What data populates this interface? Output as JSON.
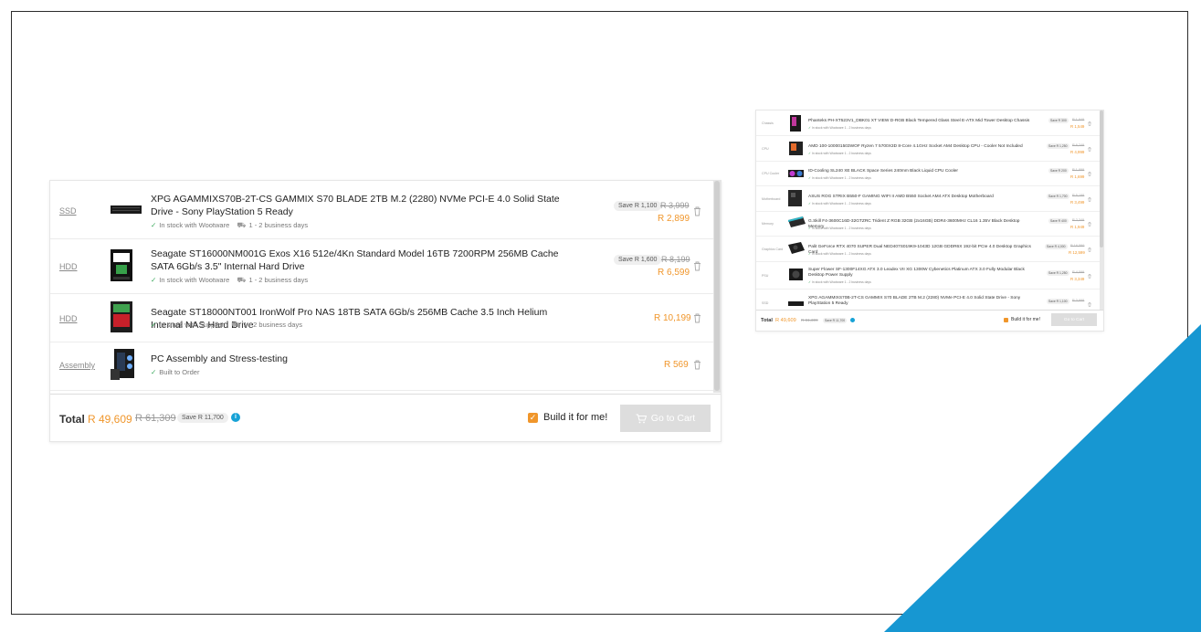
{
  "cart": {
    "items": [
      {
        "category": "SSD",
        "title": "XPG AGAMMIXS70B-2T-CS GAMMIX S70 BLADE 2TB M.2 (2280) NVMe PCI-E 4.0 Solid State Drive - Sony PlayStation 5 Ready",
        "stock": "In stock with Wootware",
        "delivery": "1 - 2 business days",
        "save": "Save R 1,100",
        "old_price": "R 3,999",
        "price": "R 2,899"
      },
      {
        "category": "HDD",
        "title": "Seagate ST16000NM001G Exos X16 512e/4Kn Standard Model 16TB 7200RPM 256MB Cache SATA 6Gb/s 3.5\" Internal Hard Drive",
        "stock": "In stock with Wootware",
        "delivery": "1 - 2 business days",
        "save": "Save R 1,600",
        "old_price": "R 8,199",
        "price": "R 6,599"
      },
      {
        "category": "HDD",
        "title": "Seagate ST18000NT001 IronWolf Pro NAS 18TB SATA 6Gb/s 256MB Cache 3.5 Inch Helium Internal NAS Hard Drive",
        "stock": "In stock with Supplier",
        "delivery": "1 - 2 business days",
        "price": "R 10,199"
      },
      {
        "category": "Assembly",
        "title": "PC Assembly and Stress-testing",
        "stock": "Built to Order",
        "price": "R 569"
      }
    ],
    "footer": {
      "total_label": "Total",
      "total_price": "R 49,609",
      "total_old": "R 61,309",
      "total_save": "Save R 11,700",
      "info_icon": "i",
      "build_label": "Build it for me!",
      "go_to_cart": "Go to Cart"
    }
  },
  "mini_cart": {
    "items": [
      {
        "category": "Chassis",
        "title": "Phanteks PH-XT523V1_DBK01 XT VIEW D-RGB Black Tempered Glass Steel E-ATX Mid Tower Desktop Chassis",
        "stock": "In stock with Wootware",
        "delivery": "1 - 2 business days",
        "save": "Save R 300",
        "old": "R 1,849",
        "price": "R 1,549"
      },
      {
        "category": "CPU",
        "title": "AMD 100-100001503WOF Ryzen 7 5700X3D 8-Core 4.1GHz Socket AM4 Desktop CPU - Cooler Not Included",
        "stock": "In stock with Wootware",
        "delivery": "1 - 2 business days",
        "save": "Save R 1,250",
        "old": "R 6,249",
        "price": "R 4,999"
      },
      {
        "category": "CPU Cooler",
        "title": "ID-Cooling SL240 XE BLACK Space Series 240mm Black Liquid CPU Cooler",
        "stock": "In stock with Wootware",
        "delivery": "1 - 2 business days",
        "save": "Save R 200",
        "old": "R 1,899",
        "price": "R 1,699"
      },
      {
        "category": "Motherboard",
        "title": "ASUS ROG STRIX B550-F GAMING WIFI II AMD B550 Socket AM4 ATX Desktop Motherboard",
        "stock": "In stock with Wootware",
        "delivery": "1 - 2 business days",
        "save": "Save R 1,700",
        "old": "R 5,199",
        "price": "R 3,499"
      },
      {
        "category": "Memory",
        "title": "G.Skill F4-3600C16D-32GTZRC Trident Z RGB 32GB (2x16GB) DDR4-3600MHz CL16 1.35V Black Desktop Memory",
        "stock": "In stock with Wootware",
        "delivery": "1 - 2 business days",
        "save": "Save R 400",
        "old": "R 2,349",
        "price": "R 1,949"
      },
      {
        "category": "Graphics Card",
        "title": "Palit GeForce RTX 4070 SUPER Dual NED407S019K9-1043D 12GB GDDR6X 192-bit PCIe 4.0 Desktop Graphics Card",
        "stock": "In stock with Wootware",
        "delivery": "1 - 2 business days",
        "save": "Save R 4,000",
        "old": "R 16,599",
        "price": "R 12,599"
      },
      {
        "category": "PSU",
        "title": "Super Flower SF-1300F14XG ATX 3.0 Leadex VII XG 1300W Cybenetics Platinum ATX 3.0 Fully Modular Black Desktop Power Supply",
        "stock": "In stock with Wootware",
        "delivery": "1 - 2 business days",
        "save": "Save R 1,250",
        "old": "R 4,599",
        "price": "R 3,349"
      },
      {
        "category": "SSD",
        "title": "XPG AGAMMIXS70B-2T-CS GAMMIX S70 BLADE 2TB M.2 (2280) NVMe PCI-E 4.0 Solid State Drive - Sony PlayStation 5 Ready",
        "save": "Save R 1,100",
        "old": "R 3,999"
      }
    ],
    "footer": {
      "total_label": "Total",
      "total_price": "R 49,609",
      "total_old": "R 61,309",
      "total_save": "Save R 11,700",
      "build_label": "Build it for me!",
      "go_to_cart": "Go to Cart"
    }
  },
  "colors": {
    "accent": "#f0962b",
    "stock_tick": "#39a85a",
    "info": "#17a2d6",
    "corner": "#1797d2"
  }
}
